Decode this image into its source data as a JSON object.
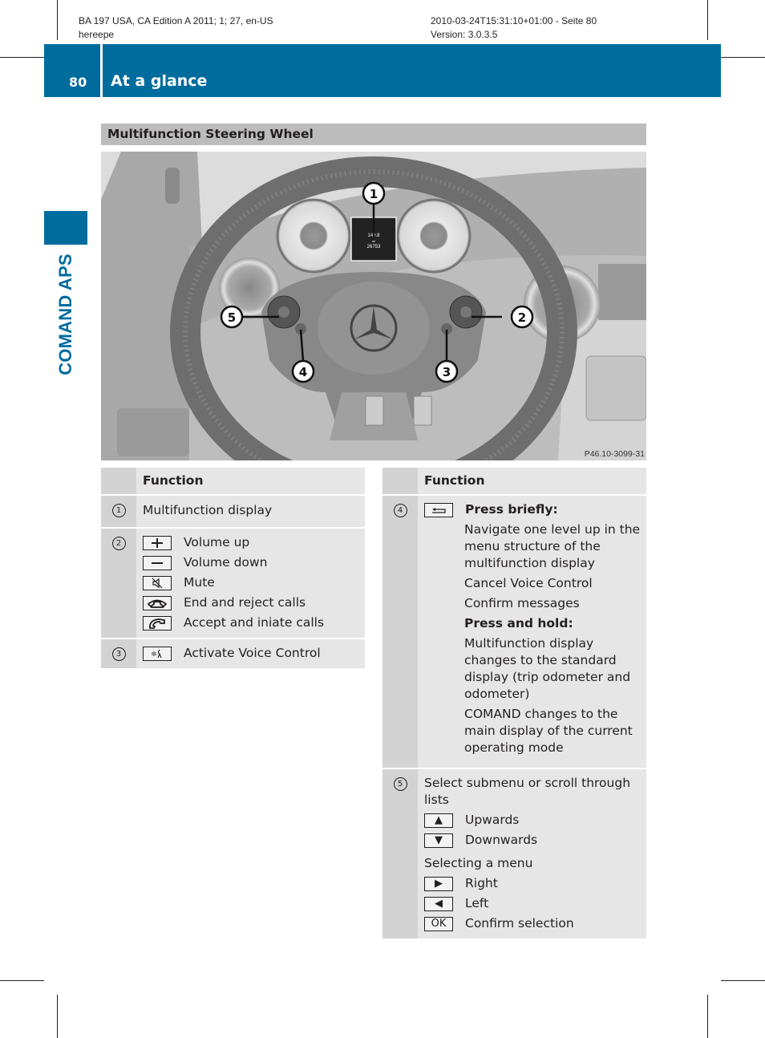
{
  "print_meta": {
    "left_line1": "BA 197 USA, CA Edition A 2011; 1; 27, en-US",
    "left_line2": "hereepe",
    "right_line1": "2010-03-24T15:31:10+01:00 - Seite 80",
    "right_line2": "Version: 3.0.3.5"
  },
  "header": {
    "page_number": "80",
    "title": "At a glance",
    "accent_color": "#006c9e"
  },
  "side_tab": {
    "label": "COMAND APS"
  },
  "section": {
    "title": "Multifunction Steering Wheel"
  },
  "figure": {
    "code": "P46.10-3099-31",
    "callouts": [
      "1",
      "2",
      "3",
      "4",
      "5"
    ],
    "display_readout": {
      "line1": "149.8",
      "line2": "mi",
      "line3": "26753"
    }
  },
  "table_left": {
    "header": "Function",
    "rows": [
      {
        "num": "1",
        "items": [
          {
            "icon": "",
            "text": "Multifunction display"
          }
        ]
      },
      {
        "num": "2",
        "items": [
          {
            "icon": "plus-key-icon",
            "text": "Volume up"
          },
          {
            "icon": "minus-key-icon",
            "text": "Volume down"
          },
          {
            "icon": "mute-key-icon",
            "text": "Mute"
          },
          {
            "icon": "end-call-key-icon",
            "text": "End and reject calls"
          },
          {
            "icon": "accept-call-key-icon",
            "text": "Accept and iniate calls"
          }
        ]
      },
      {
        "num": "3",
        "items": [
          {
            "icon": "voice-control-key-icon",
            "text": "Activate Voice Control"
          }
        ]
      }
    ]
  },
  "table_right": {
    "header": "Function",
    "row4": {
      "num": "4",
      "icon": "back-key-icon",
      "press_briefly_label": "Press briefly:",
      "press_briefly_items": [
        "Navigate one level up in the menu structure of the multifunction display",
        "Cancel Voice Control",
        "Confirm messages"
      ],
      "press_hold_label": "Press and hold:",
      "press_hold_items": [
        "Multifunction display changes to the standard display (trip odometer and odometer)",
        "COMAND changes to the main display of the current operating mode"
      ]
    },
    "row5": {
      "num": "5",
      "intro": "Select submenu or scroll through lists",
      "scroll_items": [
        {
          "icon": "up-triangle-key-icon",
          "key": "▲",
          "text": "Upwards"
        },
        {
          "icon": "down-triangle-key-icon",
          "key": "▼",
          "text": "Downwards"
        }
      ],
      "menu_label": "Selecting a menu",
      "menu_items": [
        {
          "icon": "right-triangle-key-icon",
          "key": "▶",
          "text": "Right"
        },
        {
          "icon": "left-triangle-key-icon",
          "key": "◀",
          "text": "Left"
        },
        {
          "icon": "ok-key-icon",
          "key": "OK",
          "text": "Confirm selection"
        }
      ]
    }
  }
}
